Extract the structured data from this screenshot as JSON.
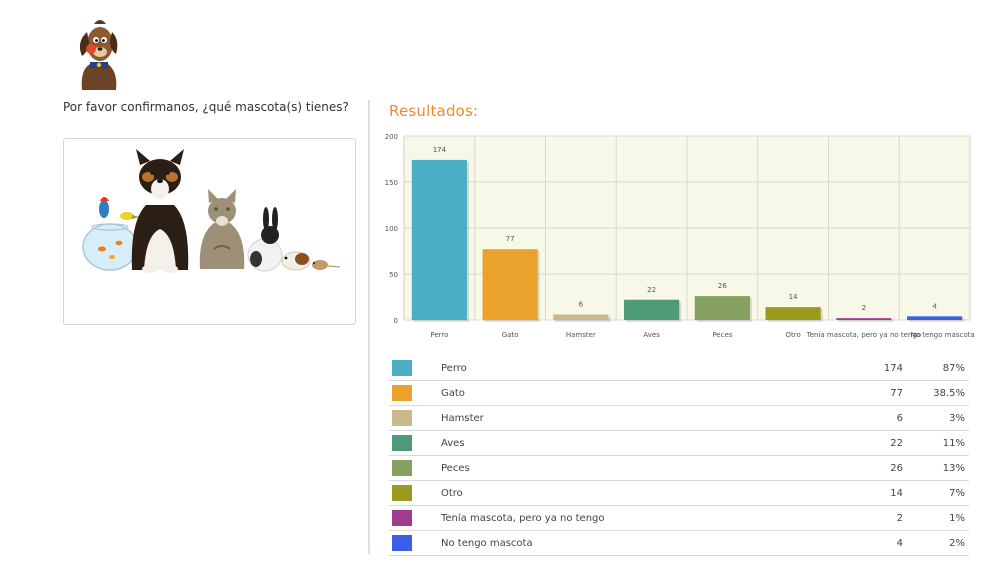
{
  "question": "Por favor confirmanos, ¿qué mascota(s) tienes?",
  "results_title": "Resultados:",
  "colors": {
    "accent": "#ee8a2e",
    "plot_bg": "#f8f8e9"
  },
  "chart_data": {
    "type": "bar",
    "categories": [
      "Perro",
      "Gato",
      "Hamster",
      "Aves",
      "Peces",
      "Otro",
      "Tenía mascota, pero ya no tengo",
      "No tengo mascota"
    ],
    "values": [
      174,
      77,
      6,
      22,
      26,
      14,
      2,
      4
    ],
    "colors": [
      "#4aafc4",
      "#eaa22c",
      "#c9b98a",
      "#4f9b79",
      "#86a060",
      "#9a9a1f",
      "#a03b8d",
      "#3b5ee6"
    ],
    "ylim": [
      0,
      200
    ],
    "yticks": [
      0,
      50,
      100,
      150,
      200
    ],
    "grid": true,
    "title": "",
    "xlabel": "",
    "ylabel": ""
  },
  "legend": [
    {
      "label": "Perro",
      "count": "174",
      "percent": "87%",
      "color": "#4aafc4"
    },
    {
      "label": "Gato",
      "count": "77",
      "percent": "38.5%",
      "color": "#eaa22c"
    },
    {
      "label": "Hamster",
      "count": "6",
      "percent": "3%",
      "color": "#c9b98a"
    },
    {
      "label": "Aves",
      "count": "22",
      "percent": "11%",
      "color": "#4f9b79"
    },
    {
      "label": "Peces",
      "count": "26",
      "percent": "13%",
      "color": "#86a060"
    },
    {
      "label": "Otro",
      "count": "14",
      "percent": "7%",
      "color": "#9a9a1f"
    },
    {
      "label": "Tenía mascota, pero ya no tengo",
      "count": "2",
      "percent": "1%",
      "color": "#a03b8d"
    },
    {
      "label": "No tengo mascota",
      "count": "4",
      "percent": "2%",
      "color": "#3b5ee6"
    }
  ]
}
